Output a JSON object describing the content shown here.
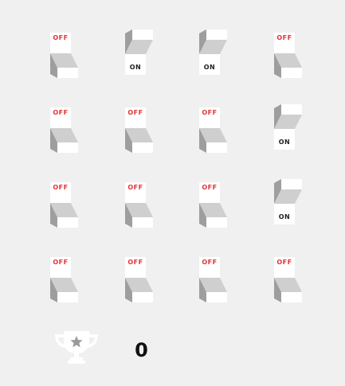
{
  "game": {
    "off_label": "OFF",
    "on_label": "ON",
    "score": "0",
    "colors": {
      "background": "#f0f0f0",
      "off_text": "#e0343a",
      "on_text": "#222222",
      "trophy": "#ffffff",
      "star": "#9a9a9a"
    },
    "grid": [
      [
        "off",
        "on",
        "on",
        "off"
      ],
      [
        "off",
        "off",
        "off",
        "on"
      ],
      [
        "off",
        "off",
        "off",
        "on"
      ],
      [
        "off",
        "off",
        "off",
        "off"
      ]
    ]
  }
}
